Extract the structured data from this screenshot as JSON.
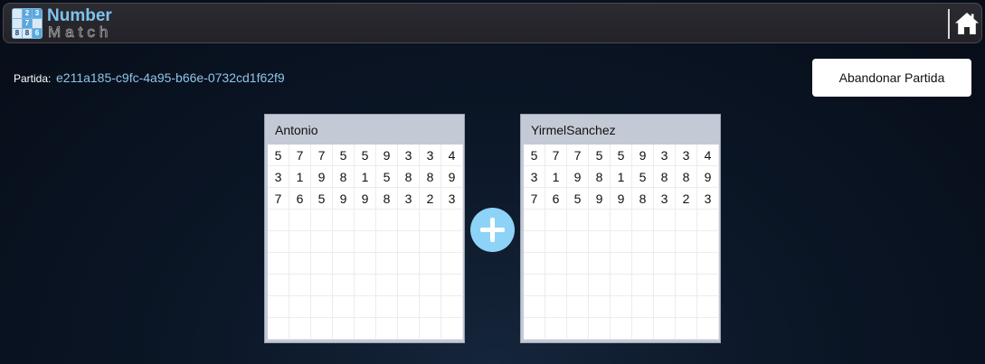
{
  "header": {
    "logo_digits": [
      "",
      "2",
      "3",
      "",
      "7",
      "",
      "8",
      "8",
      "6"
    ],
    "brand_line1": "Number",
    "brand_line2": "Match",
    "home_icon": "home-icon"
  },
  "game": {
    "partida_label": "Partida:",
    "partida_id": "e211a185-c9fc-4a95-b66e-0732cd1f62f9",
    "abandon_label": "Abandonar Partida"
  },
  "boards": [
    {
      "player": "Antonio",
      "rows": [
        [
          "5",
          "7",
          "7",
          "5",
          "5",
          "9",
          "3",
          "3",
          "4"
        ],
        [
          "3",
          "1",
          "9",
          "8",
          "1",
          "5",
          "8",
          "8",
          "9"
        ],
        [
          "7",
          "6",
          "5",
          "9",
          "9",
          "8",
          "3",
          "2",
          "3"
        ],
        [
          "",
          "",
          "",
          "",
          "",
          "",
          "",
          "",
          ""
        ],
        [
          "",
          "",
          "",
          "",
          "",
          "",
          "",
          "",
          ""
        ],
        [
          "",
          "",
          "",
          "",
          "",
          "",
          "",
          "",
          ""
        ],
        [
          "",
          "",
          "",
          "",
          "",
          "",
          "",
          "",
          ""
        ],
        [
          "",
          "",
          "",
          "",
          "",
          "",
          "",
          "",
          ""
        ],
        [
          "",
          "",
          "",
          "",
          "",
          "",
          "",
          "",
          ""
        ]
      ]
    },
    {
      "player": "YirmelSanchez",
      "rows": [
        [
          "5",
          "7",
          "7",
          "5",
          "5",
          "9",
          "3",
          "3",
          "4"
        ],
        [
          "3",
          "1",
          "9",
          "8",
          "1",
          "5",
          "8",
          "8",
          "9"
        ],
        [
          "7",
          "6",
          "5",
          "9",
          "9",
          "8",
          "3",
          "2",
          "3"
        ],
        [
          "",
          "",
          "",
          "",
          "",
          "",
          "",
          "",
          ""
        ],
        [
          "",
          "",
          "",
          "",
          "",
          "",
          "",
          "",
          ""
        ],
        [
          "",
          "",
          "",
          "",
          "",
          "",
          "",
          "",
          ""
        ],
        [
          "",
          "",
          "",
          "",
          "",
          "",
          "",
          "",
          ""
        ],
        [
          "",
          "",
          "",
          "",
          "",
          "",
          "",
          "",
          ""
        ],
        [
          "",
          "",
          "",
          "",
          "",
          "",
          "",
          "",
          ""
        ]
      ]
    }
  ],
  "add_icon": "plus-icon",
  "colors": {
    "accent": "#8dd3f7",
    "id_text": "#8fc5ea",
    "board_frame": "#c4c9d6"
  }
}
